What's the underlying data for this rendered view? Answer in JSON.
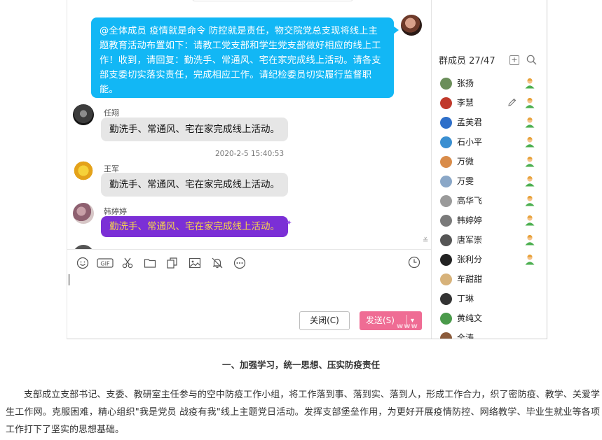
{
  "chat": {
    "announcement": "@全体成员 疫情就是命令 防控就是责任，物交院党总支现将线上主题教育活动布置如下：请教工党支部和学生党支部做好相应的线上工作！收到，请回复：勤洗手、常通风、宅在家完成线上活动。请各支部支委切实落实责任，完成相应工作。请纪检委员切实履行监督职能。",
    "messages": [
      {
        "sender": "任翔",
        "text": "勤洗手、常通风、宅在家完成线上活动。"
      },
      {
        "sender": "王军",
        "text": "勤洗手、常通风、宅在家完成线上活动。"
      },
      {
        "sender": "韩婷婷",
        "text": "勤洗手、常通风、宅在家完成线上活动。"
      }
    ],
    "timestamp": "2020-2-5 15:40:53",
    "collapse_glyph": "≚"
  },
  "toolbar": {
    "icons": [
      "emoji-icon",
      "gif-icon",
      "scissors-icon",
      "folder-icon",
      "file-transfer-icon",
      "image-icon",
      "bell-off-icon",
      "more-icon",
      "history-icon"
    ],
    "gif_label": "GIF"
  },
  "actions": {
    "close_label": "关闭(C)",
    "send_label": "发送(S)",
    "send_arrow": "▾",
    "watermark": "www"
  },
  "members": {
    "header": "群成员 27/47",
    "list": [
      {
        "name": "张扬",
        "color": "#6b8e5a"
      },
      {
        "name": "李慧",
        "color": "#c0392b"
      },
      {
        "name": "孟芙君",
        "color": "#2e6fc9"
      },
      {
        "name": "石小平",
        "color": "#3a8fd1"
      },
      {
        "name": "万微",
        "color": "#d98c4a"
      },
      {
        "name": "万雯",
        "color": "#8aa7c7"
      },
      {
        "name": "高华飞",
        "color": "#9a9a9a"
      },
      {
        "name": "韩婷婷",
        "color": "#7a7a7a"
      },
      {
        "name": "唐军崇",
        "color": "#555555"
      },
      {
        "name": "张利分",
        "color": "#222222"
      },
      {
        "name": "车甜甜",
        "color": "#d7b27a"
      },
      {
        "name": "丁琳",
        "color": "#333333"
      },
      {
        "name": "黄纯文",
        "color": "#4a9a4a"
      },
      {
        "name": "全涛",
        "color": "#8b5a3a"
      }
    ],
    "online_count": 10,
    "online_color": "#4caf50"
  },
  "article": {
    "heading": "一、加强学习，统一思想、压实防疫责任",
    "paragraph": "支部成立支部书记、支委、教研室主任参与的空中防疫工作小组，将工作落到事、落到实、落到人，形成工作合力，织了密防疫、教学、关爱学生工作网。克服困难，精心组织\"我是党员 战疫有我\"线上主题党日活动。发挥支部堡垒作用，为更好开展疫情防控、网络教学、毕业生就业等各项工作打下了坚实的思想基础。"
  },
  "colors": {
    "announcement_bg": "#12b7f5",
    "purple_bubble": "#7b2fd6",
    "purple_text": "#f6d54a",
    "send_button": "#ef6c94"
  }
}
